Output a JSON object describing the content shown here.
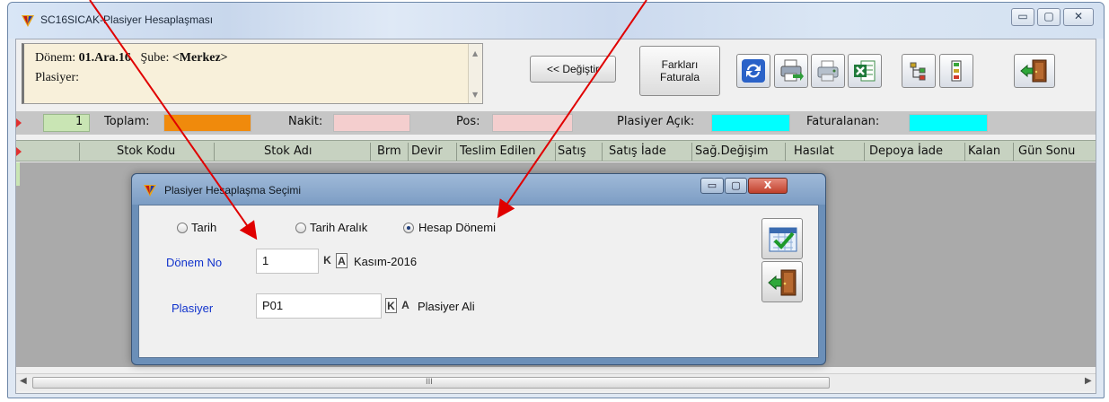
{
  "window": {
    "title": "SC16SICAK-Plasiyer Hesaplaşması",
    "minimize": "▭",
    "maximize": "▢",
    "close": "✕"
  },
  "info": {
    "donem_label": "Dönem:",
    "donem_value": "01.Ara.16",
    "sube_label": "Şube:",
    "sube_value": "<Merkez>",
    "plasiyer_label": "Plasiyer:"
  },
  "buttons": {
    "degistir": "<< Değiştir",
    "farklari_line1": "Farkları",
    "farklari_line2": "Faturala"
  },
  "toolbar_icons": [
    "refresh-icon",
    "print-export-icon",
    "print-icon",
    "excel-icon",
    "tree-icon",
    "list-tree-icon",
    "exit-door-icon"
  ],
  "totals": {
    "row_number": "1",
    "toplam": "Toplam:",
    "nakit": "Nakit:",
    "pos": "Pos:",
    "plasiyer_acik": "Plasiyer Açık:",
    "faturalanan": "Faturalanan:"
  },
  "grid": {
    "columns": [
      "Stok Kodu",
      "Stok Adı",
      "Brm",
      "Devir",
      "Teslim Edilen",
      "Satış",
      "Satış İade",
      "Sağ.Değişim",
      "Hasılat",
      "Depoya İade",
      "Kalan",
      "Gün Sonu"
    ]
  },
  "scrollbar": {
    "grip": "III"
  },
  "dialog": {
    "title": "Plasiyer Hesaplaşma Seçimi",
    "minimize": "▭",
    "maximize": "▢",
    "close": "X",
    "radios": [
      {
        "label": "Tarih",
        "selected": false
      },
      {
        "label": "Tarih Aralık",
        "selected": false
      },
      {
        "label": "Hesap Dönemi",
        "selected": true
      }
    ],
    "donem_no_label": "Dönem No",
    "donem_no_value": "1",
    "donem_k": "K",
    "donem_a": "A",
    "donem_desc": "Kasım-2016",
    "plasiyer_label": "Plasiyer",
    "plasiyer_value": "P01",
    "plasiyer_k": "K",
    "plasiyer_a": "A",
    "plasiyer_desc": "Plasiyer Ali"
  },
  "colors": {
    "toplam_fill": "#f08a0c",
    "nakit_fill": "#f4cece",
    "pos_fill": "#f4cece",
    "cyan_fill": "#00ffff",
    "annotation_arrow": "#e00000"
  }
}
